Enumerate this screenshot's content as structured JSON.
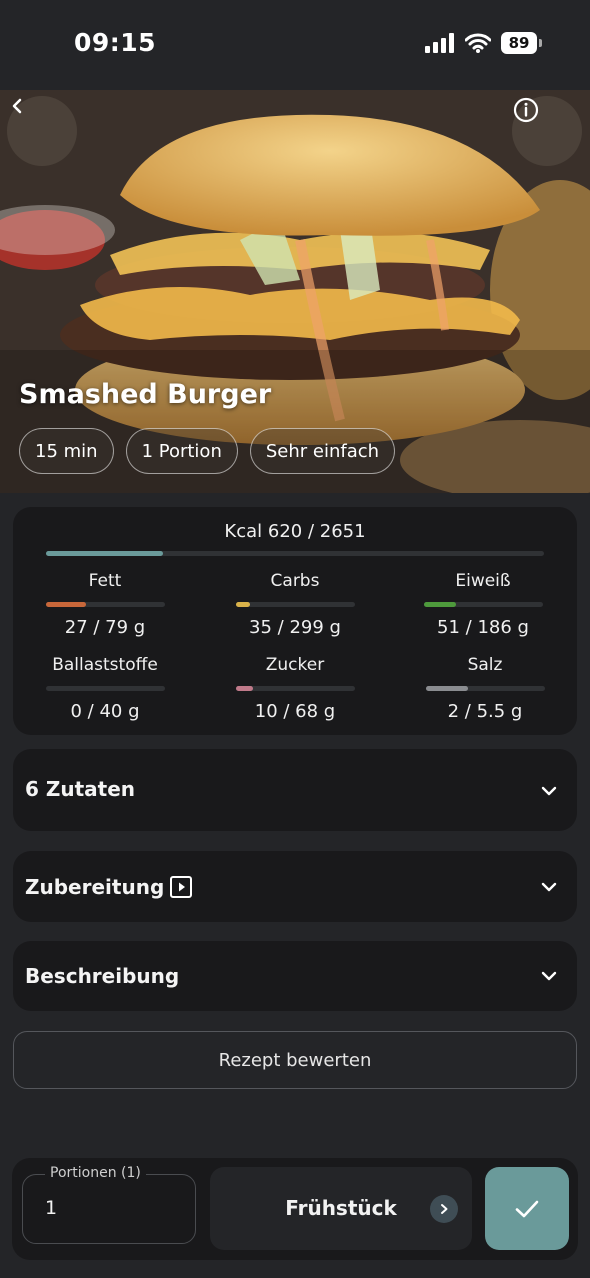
{
  "status_bar": {
    "time": "09:15",
    "battery": "89"
  },
  "recipe": {
    "title": "Smashed Burger",
    "chips": [
      "15 min",
      "1 Portion",
      "Sehr einfach"
    ]
  },
  "nutrition": {
    "kcal": {
      "label": "Kcal 620 / 2651",
      "fraction": 0.234,
      "color": "#6a9a9a"
    },
    "macros": [
      {
        "name": "Fett",
        "value": "27 / 79 g",
        "fraction": 0.34,
        "color": "#c8673a"
      },
      {
        "name": "Carbs",
        "value": "35 / 299 g",
        "fraction": 0.12,
        "color": "#d9b24a"
      },
      {
        "name": "Eiweiß",
        "value": "51 / 186 g",
        "fraction": 0.27,
        "color": "#4e9a3c"
      },
      {
        "name": "Ballaststoffe",
        "value": "0 / 40 g",
        "fraction": 0.0,
        "color": "#7a7a7a"
      },
      {
        "name": "Zucker",
        "value": "10 / 68 g",
        "fraction": 0.15,
        "color": "#c07a8a"
      },
      {
        "name": "Salz",
        "value": "2 / 5.5 g",
        "fraction": 0.36,
        "color": "#8a8c90"
      }
    ]
  },
  "sections": {
    "ingredients": "6 Zutaten",
    "preparation": "Zubereitung",
    "description": "Beschreibung"
  },
  "rate_button": "Rezept bewerten",
  "bottom_bar": {
    "portions_label": "Portionen (1)",
    "portions_value": "1",
    "meal": "Frühstück"
  },
  "icons": {
    "back": "chevron-left-icon",
    "info": "info-icon",
    "expand": "chevron-down-icon",
    "video": "play-icon",
    "confirm": "check-icon"
  }
}
